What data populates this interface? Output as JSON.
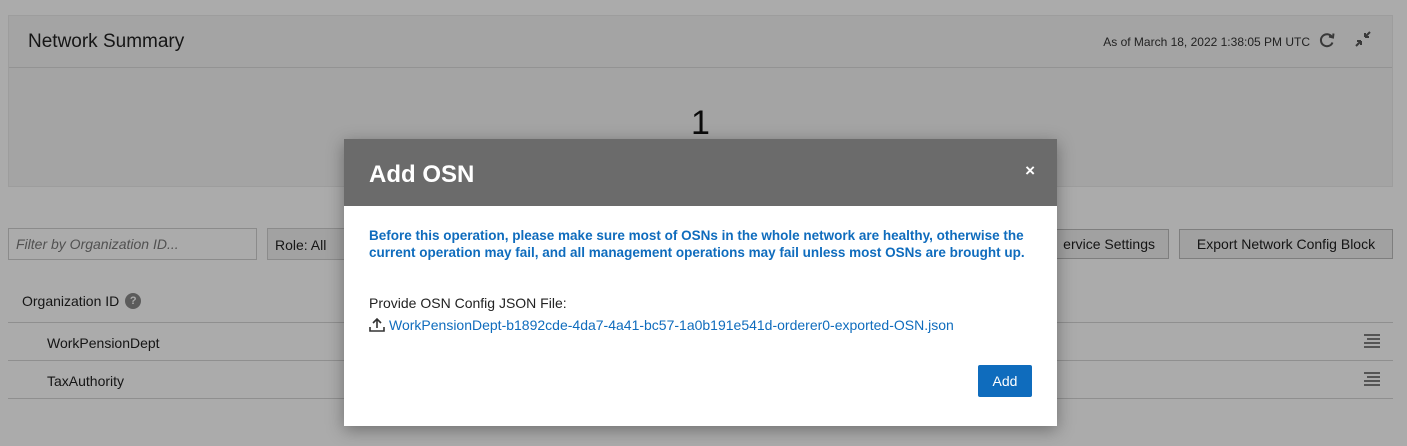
{
  "summary": {
    "title": "Network Summary",
    "as_of": "As of March 18, 2022 1:38:05 PM UTC",
    "count": "1",
    "refresh_icon": "refresh-icon",
    "collapse_icon": "collapse-icon"
  },
  "toolbar": {
    "filter_placeholder": "Filter by Organization ID...",
    "role_label": "Role: All",
    "service_settings_label": "ervice Settings",
    "export_label": "Export Network Config Block"
  },
  "table": {
    "column_header": "Organization ID",
    "help_icon_glyph": "?",
    "rows": [
      {
        "name": "WorkPensionDept"
      },
      {
        "name": "TaxAuthority"
      }
    ]
  },
  "dialog": {
    "title": "Add OSN",
    "close_glyph": "×",
    "warning": "Before this operation, please make sure most of OSNs in the whole network are healthy, otherwise the current operation may fail, and all management operations may fail unless most OSNs are brought up.",
    "file_label": "Provide OSN Config JSON File:",
    "file_name": "WorkPensionDept-b1892cde-4da7-4a41-bc57-1a0b191e541d-orderer0-exported-OSN.json",
    "add_label": "Add"
  },
  "colors": {
    "accent": "#0f6cbd",
    "dialog_header": "#6b6b6b",
    "overlay": "rgba(0,0,0,0.33)"
  }
}
